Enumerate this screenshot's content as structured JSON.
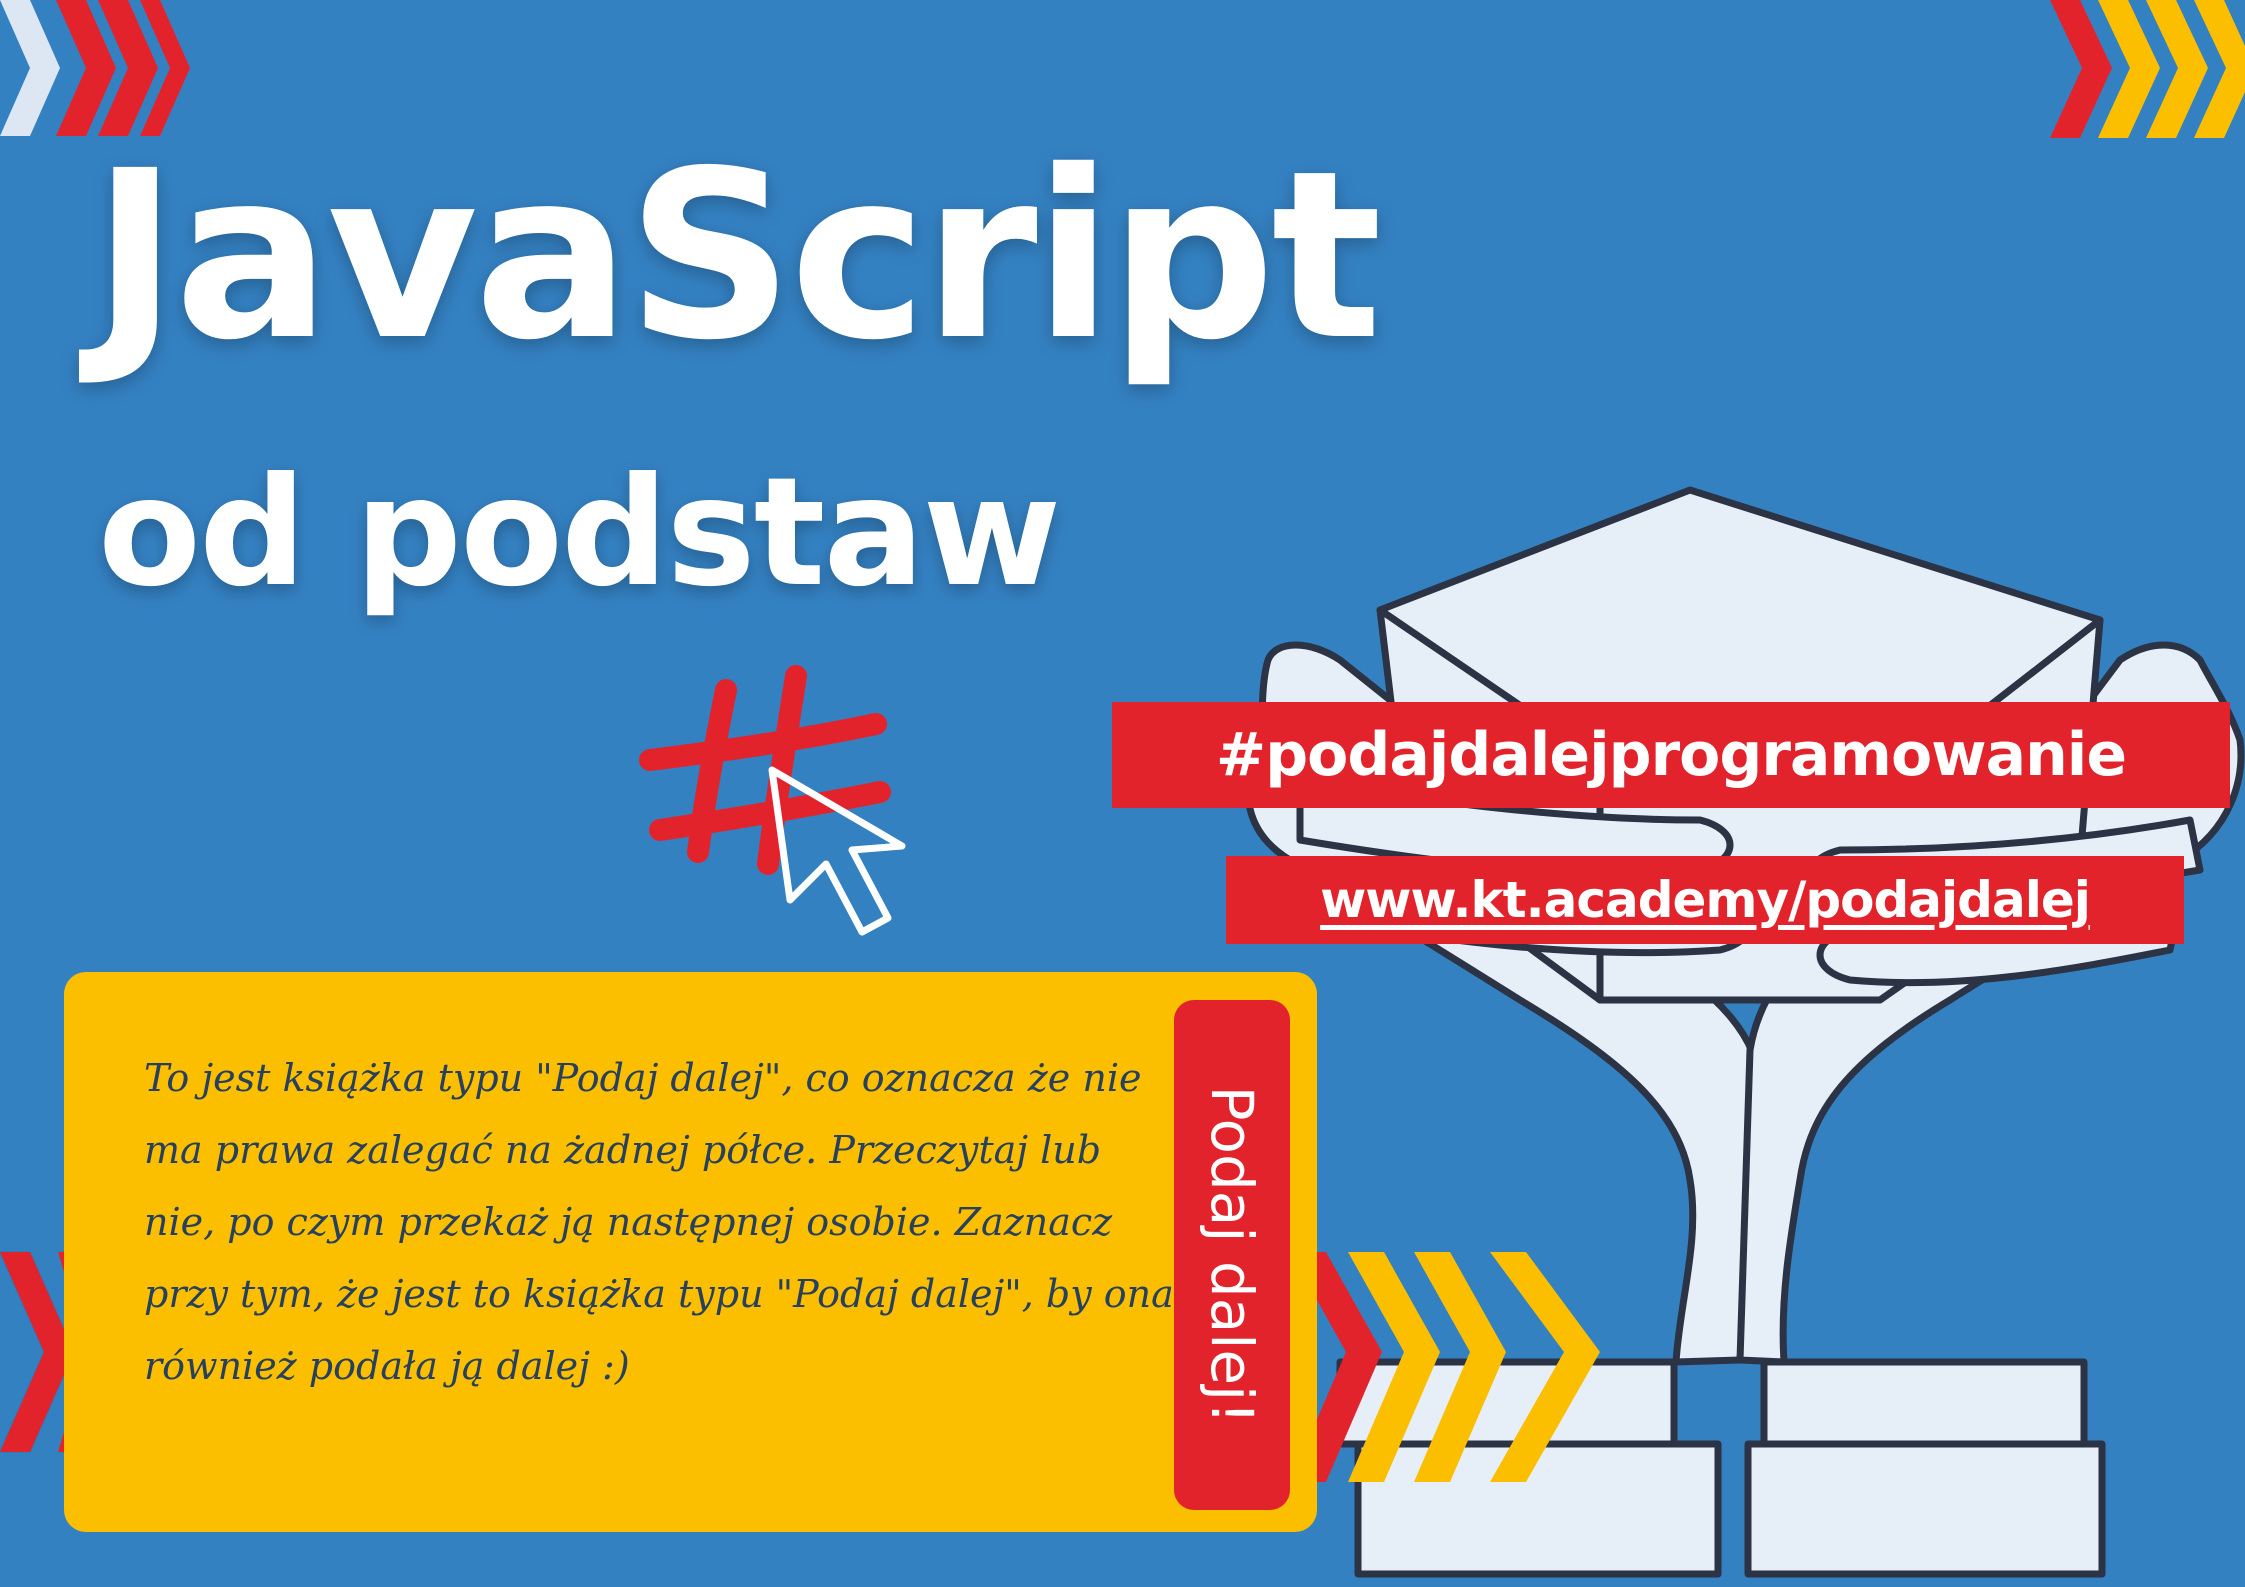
{
  "poster": {
    "title": "JavaScript",
    "subtitle": "od podstaw",
    "hashtag": "#podajdalejprogramowanie",
    "url": "www.kt.academy/podajdalej",
    "description": "To jest książka typu \"Podaj dalej\", co oznacza że nie ma prawa zalegać na żadnej półce. Przeczytaj lub nie, po czym przekaż ją następnej osobie. Zaznacz przy tym, że jest to książka typu \"Podaj dalej\", by ona również podała ją dalej :)",
    "side_label": "Podaj dalej!"
  },
  "colors": {
    "background": "#3481c2",
    "accent_red": "#e3232c",
    "accent_yellow": "#fbbf00",
    "chevron_light": "#dde7f4",
    "hands_fill": "#e6eef8",
    "hands_outline": "#2b3345",
    "text_dark": "#27405e"
  },
  "icons": [
    "hash-symbol-icon",
    "mouse-cursor-icon",
    "hands-holding-box-illustration",
    "chevron-arrows-icon"
  ]
}
